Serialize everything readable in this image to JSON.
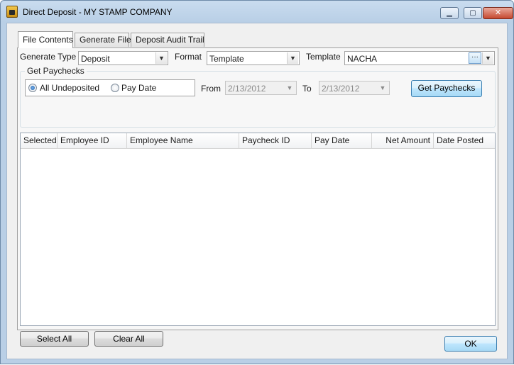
{
  "window": {
    "title": "Direct Deposit - MY STAMP COMPANY",
    "controls": {
      "minimize": "▁",
      "maximize": "▢",
      "close": "✕"
    }
  },
  "tabs": [
    {
      "label": "File Contents",
      "active": true
    },
    {
      "label": "Generate File",
      "active": false
    },
    {
      "label": "Deposit Audit Trail",
      "active": false
    }
  ],
  "settings": {
    "generate_type_label": "Generate Type",
    "generate_type_value": "Deposit",
    "format_label": "Format",
    "format_value": "Template",
    "template_label": "Template",
    "template_value": "NACHA",
    "ellipsis": "···"
  },
  "get_paychecks": {
    "group_title": "Get Paychecks",
    "radio_all_undeposited": "All Undeposited",
    "radio_pay_date": "Pay Date",
    "selected_radio": "all_undeposited",
    "from_label": "From",
    "from_value": "2/13/2012",
    "to_label": "To",
    "to_value": "2/13/2012",
    "button_label": "Get Paychecks"
  },
  "grid": {
    "columns": [
      "Selected",
      "Employee ID",
      "Employee Name",
      "Paycheck ID",
      "Pay Date",
      "Net Amount",
      "Date Posted"
    ],
    "rows": []
  },
  "buttons": {
    "select_all": "Select All",
    "clear_all": "Clear All",
    "ok": "OK"
  },
  "icons": {
    "app": "stamp-app-icon",
    "dropdown": "chevron-down-icon",
    "annotation_arrow": "red-arrow-annotation"
  },
  "colors": {
    "window_frame": "#b9cfe6",
    "close_button": "#c6482f",
    "annotation_arrow": "#d62020",
    "button_focus": "#3c7fb1"
  }
}
